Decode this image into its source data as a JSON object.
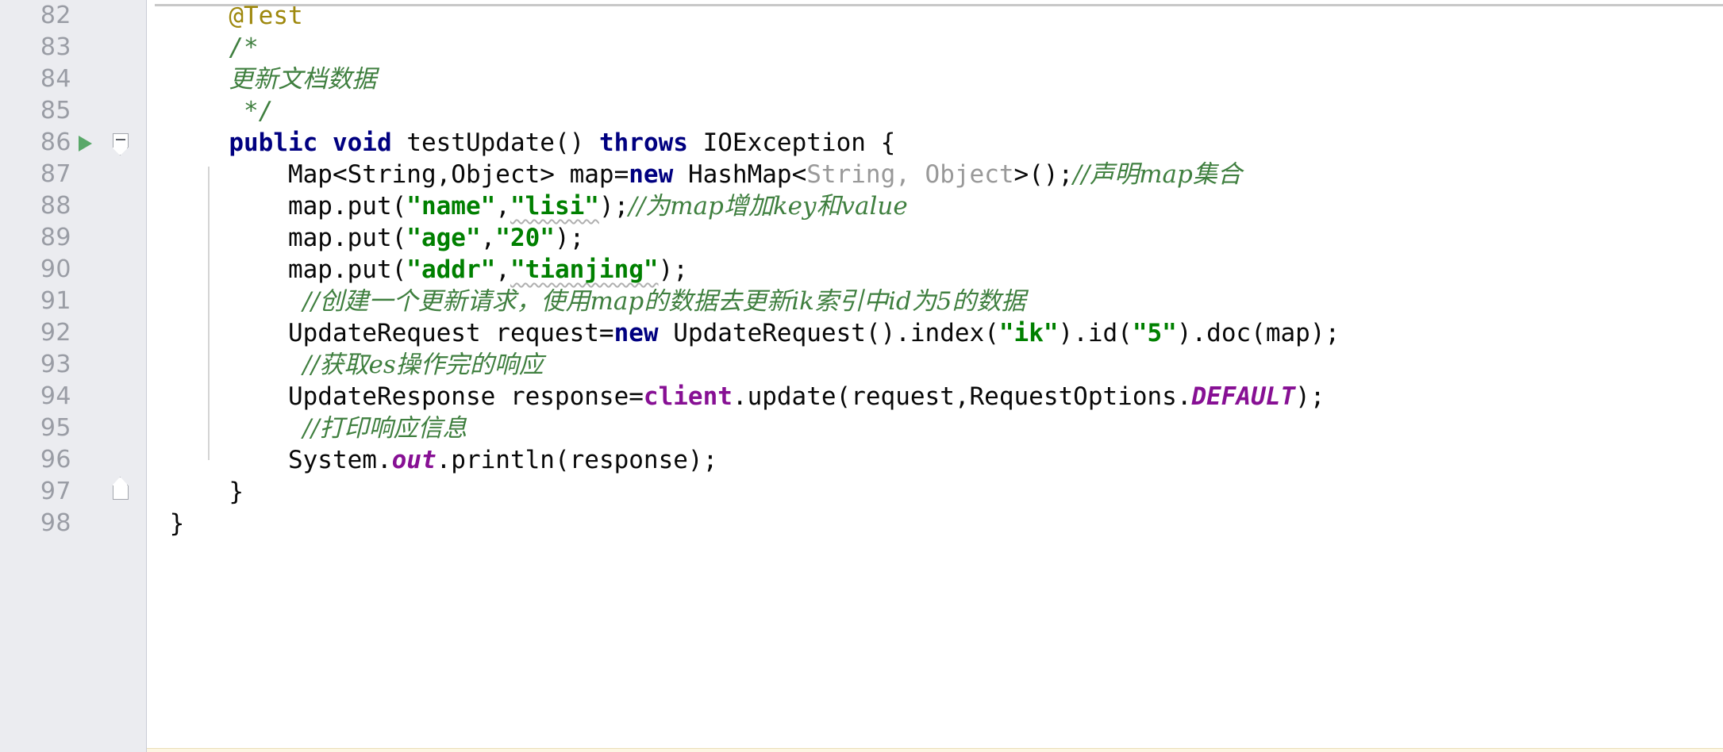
{
  "editor": {
    "app": "intellij-idea-java-editor",
    "language": "Java",
    "first_line": 82,
    "last_line": 98,
    "colors": {
      "background": "#ffffff",
      "gutter_background": "#ebecf0",
      "line_number": "#9a9da5",
      "keyword": "#000080",
      "string": "#008000",
      "comment": "#3f7f3f",
      "type_hint": "#999999",
      "field": "#871094",
      "annotation": "#9e880d",
      "text": "#080808",
      "run_marker": "#59a869"
    }
  },
  "gutter": {
    "line_numbers": [
      "82",
      "83",
      "84",
      "85",
      "86",
      "87",
      "88",
      "89",
      "90",
      "91",
      "92",
      "93",
      "94",
      "95",
      "96",
      "97",
      "98"
    ],
    "run_marker_line": "86",
    "run_marker_tooltip": "Run test",
    "fold_start_line": "86",
    "fold_end_line": "97"
  },
  "code": {
    "lines": [
      {
        "n": "82",
        "text": "    @Test"
      },
      {
        "n": "83",
        "text": "    /*"
      },
      {
        "n": "84",
        "text": "    更新文档数据"
      },
      {
        "n": "85",
        "text": "     */"
      },
      {
        "n": "86",
        "text": "    public void testUpdate() throws IOException {"
      },
      {
        "n": "87",
        "text": "        Map<String,Object> map=new HashMap<String, Object>();//声明map集合"
      },
      {
        "n": "88",
        "text": "        map.put(\"name\",\"lisi\");//为map增加key和value"
      },
      {
        "n": "89",
        "text": "        map.put(\"age\",\"20\");"
      },
      {
        "n": "90",
        "text": "        map.put(\"addr\",\"tianjing\");"
      },
      {
        "n": "91",
        "text": "        //创建一个更新请求，使用map的数据去更新ik索引中id为5的数据"
      },
      {
        "n": "92",
        "text": "        UpdateRequest request=new UpdateRequest().index(\"ik\").id(\"5\").doc(map);"
      },
      {
        "n": "93",
        "text": "        //获取es操作完的响应"
      },
      {
        "n": "94",
        "text": "        UpdateResponse response=client.update(request,RequestOptions.DEFAULT);"
      },
      {
        "n": "95",
        "text": "        //打印响应信息"
      },
      {
        "n": "96",
        "text": "        System.out.println(response);"
      },
      {
        "n": "97",
        "text": "    }"
      },
      {
        "n": "98",
        "text": "}"
      }
    ],
    "tokens": {
      "annotation_test": "@Test",
      "block_comment_open": "/*",
      "block_comment_body": "更新文档数据",
      "block_comment_close": "*/",
      "kw_public": "public",
      "kw_void": "void",
      "method_name": "testUpdate()",
      "kw_throws": "throws",
      "exception_type": "IOException",
      "brace_open": "{",
      "map_decl_type": "Map<String,Object>",
      "map_var": "map=",
      "kw_new": "new",
      "hashmap_name": "HashMap<",
      "hashmap_typehint": "String, Object",
      "hashmap_tail": ">();",
      "comment_declare_map": "//声明map集合",
      "put_name_call_a": "map.put(",
      "str_name": "\"name\"",
      "comma": ",",
      "str_lisi": "\"lisi\"",
      "call_close": ");",
      "comment_add_kv": "//为map增加key和value",
      "str_age": "\"age\"",
      "str_20": "\"20\"",
      "str_addr": "\"addr\"",
      "str_tianjing": "\"tianjing\"",
      "comment_create_request": "//创建一个更新请求，使用map的数据去更新ik索引中id为5的数据",
      "update_request_type": "UpdateRequest",
      "request_var": " request=",
      "update_request_ctor": " UpdateRequest().index(",
      "str_ik": "\"ik\"",
      "dot_id": ").id(",
      "str_5": "\"5\"",
      "doc_map_tail": ").doc(map);",
      "comment_get_response": "//获取es操作完的响应",
      "update_response_type": "UpdateResponse",
      "response_var": " response=",
      "client_field": "client",
      "update_call": ".update(request,RequestOptions.",
      "default_const": "DEFAULT",
      "update_call_close": ");",
      "comment_print_response": "//打印响应信息",
      "system_prefix": "System.",
      "out_field": "out",
      "println_call": ".println(response);",
      "brace_close": "}"
    }
  }
}
